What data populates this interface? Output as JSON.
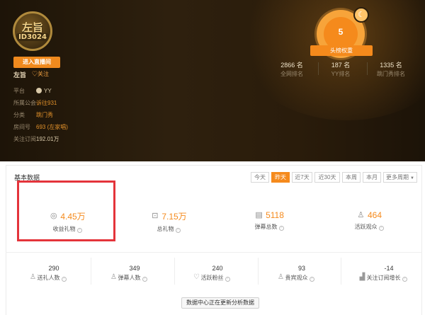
{
  "profile": {
    "avatar_line1": "左旨",
    "avatar_line2": "ID3024",
    "enter_button": "进入直播间",
    "name": "左旨",
    "follow_label": "♡关注",
    "info": [
      {
        "key": "平台",
        "value": "YY"
      },
      {
        "key": "所属公会",
        "value": "诉往931"
      },
      {
        "key": "分类",
        "value": "跳门秀"
      },
      {
        "key": "房间号",
        "value": "693 (左家唱)"
      },
      {
        "key": "关注订阅",
        "value": "192.01万"
      }
    ]
  },
  "badge": {
    "level": "5",
    "moon_glyph": "☾",
    "ribbon": "头榜权重"
  },
  "ranks": [
    {
      "value": "2866 名",
      "label": "全网排名"
    },
    {
      "value": "187 名",
      "label": "YY排名"
    },
    {
      "value": "1335 名",
      "label": "跳门秀排名"
    }
  ],
  "panel": {
    "title": "基本数据",
    "tabs": [
      "今天",
      "昨天",
      "近7天",
      "近30天",
      "本周",
      "本月",
      "更多周期"
    ],
    "active_tab": "昨天"
  },
  "stats_main": [
    {
      "icon": "coin-icon",
      "glyph": "◎",
      "value": "4.45万",
      "label": "收益礼物"
    },
    {
      "icon": "gift-icon",
      "glyph": "⊡",
      "value": "7.15万",
      "label": "总礼物"
    },
    {
      "icon": "barrage-icon",
      "glyph": "▤",
      "value": "5118",
      "label": "弹幕总数"
    },
    {
      "icon": "users-icon",
      "glyph": "♙",
      "value": "464",
      "label": "活跃观众"
    }
  ],
  "stats_secondary": [
    {
      "icon": "gift-people-icon",
      "glyph": "♙",
      "value": "290",
      "label": "送礼人数"
    },
    {
      "icon": "barrage-people-icon",
      "glyph": "♙",
      "value": "349",
      "label": "弹幕人数"
    },
    {
      "icon": "heart-icon",
      "glyph": "♡",
      "value": "240",
      "label": "活跃粉丝"
    },
    {
      "icon": "vip-icon",
      "glyph": "♙",
      "value": "93",
      "label": "贵宾观众"
    },
    {
      "icon": "trend-icon",
      "glyph": "▟",
      "value": "-14",
      "label": "关注订阅增长"
    }
  ],
  "tip": "数据中心正在更新分析数据"
}
